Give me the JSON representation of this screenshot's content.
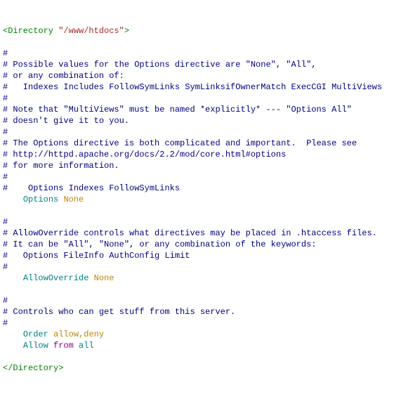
{
  "l1": {
    "open": "<Directory ",
    "path": "\"/www/htdocs\"",
    "close": ">"
  },
  "c1": "#",
  "c2": "# Possible values for the Options directive are \"None\", \"All\",",
  "c3": "# or any combination of:",
  "c4": "#   Indexes Includes FollowSymLinks SymLinksifOwnerMatch ExecCGI MultiViews",
  "c5": "#",
  "c6": "# Note that \"MultiViews\" must be named *explicitly* --- \"Options All\"",
  "c7": "# doesn't give it to you.",
  "c8": "#",
  "c9": "# The Options directive is both complicated and important.  Please see",
  "c10": "# http://httpd.apache.org/docs/2.2/mod/core.html#options",
  "c11": "# for more information.",
  "c12": "#",
  "c13": "#    Options Indexes FollowSymLinks",
  "opt": {
    "kw": "Options",
    "val": "None"
  },
  "c14": "#",
  "c15": "# AllowOverride controls what directives may be placed in .htaccess files.",
  "c16": "# It can be \"All\", \"None\", or any combination of the keywords:",
  "c17": "#   Options FileInfo AuthConfig Limit",
  "c18": "#",
  "ao": {
    "kw": "AllowOverride",
    "val": "None"
  },
  "c19": "#",
  "c20": "# Controls who can get stuff from this server.",
  "c21": "#",
  "ord": {
    "kw": "Order",
    "val": "allow,deny"
  },
  "alw": {
    "kw": "Allow",
    "from": "from",
    "val": "all"
  },
  "close": "</Directory>"
}
